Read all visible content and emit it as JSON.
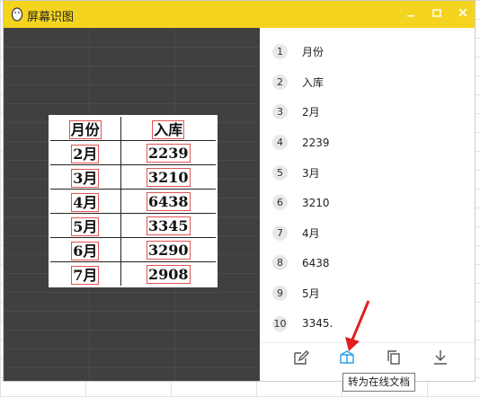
{
  "window": {
    "title": "屏幕识图",
    "accent": "#f5d41f"
  },
  "ocr_table": {
    "headers": [
      "月份",
      "入库"
    ],
    "rows": [
      [
        "2月",
        "2239"
      ],
      [
        "3月",
        "3210"
      ],
      [
        "4月",
        "6438"
      ],
      [
        "5月",
        "3345"
      ],
      [
        "6月",
        "3290"
      ],
      [
        "7月",
        "2908"
      ]
    ]
  },
  "results": [
    {
      "index": "1",
      "text": "月份"
    },
    {
      "index": "2",
      "text": "入库"
    },
    {
      "index": "3",
      "text": "2月"
    },
    {
      "index": "4",
      "text": "2239"
    },
    {
      "index": "5",
      "text": "3月"
    },
    {
      "index": "6",
      "text": "3210"
    },
    {
      "index": "7",
      "text": "4月"
    },
    {
      "index": "8",
      "text": "6438"
    },
    {
      "index": "9",
      "text": "5月"
    },
    {
      "index": "10",
      "text": "3345."
    }
  ],
  "toolbar": {
    "tooltip": "转为在线文档",
    "icons": [
      "edit-icon",
      "convert-doc-icon",
      "copy-icon",
      "download-icon"
    ],
    "active_color": "#2a9de8"
  }
}
